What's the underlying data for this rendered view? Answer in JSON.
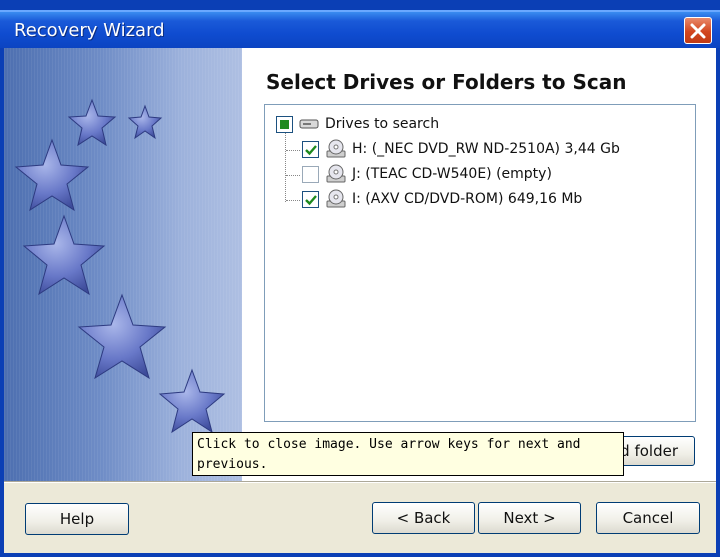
{
  "window": {
    "title": "Recovery Wizard"
  },
  "main": {
    "heading": "Select Drives or Folders to Scan",
    "tree": {
      "root_label": "Drives to search",
      "items": [
        {
          "label": "H: (_NEC  DVD_RW ND-2510A) 3,44 Gb",
          "checked": true
        },
        {
          "label": "J: (TEAC  CD-W540E) (empty)",
          "checked": false
        },
        {
          "label": "I: (AXV  CD/DVD-ROM) 649,16 Mb",
          "checked": true
        }
      ]
    },
    "add_folder_label": "d folder"
  },
  "tooltip": {
    "text": "Click to close image. Use arrow keys for next and previous."
  },
  "footer": {
    "help_label": "Help",
    "back_label": "< Back",
    "next_label": "Next >",
    "cancel_label": "Cancel"
  },
  "colors": {
    "titlebar": "#0b44c2",
    "client": "#ece9d8",
    "check_green": "#1f8a1f",
    "tooltip_bg": "#ffffe1"
  }
}
